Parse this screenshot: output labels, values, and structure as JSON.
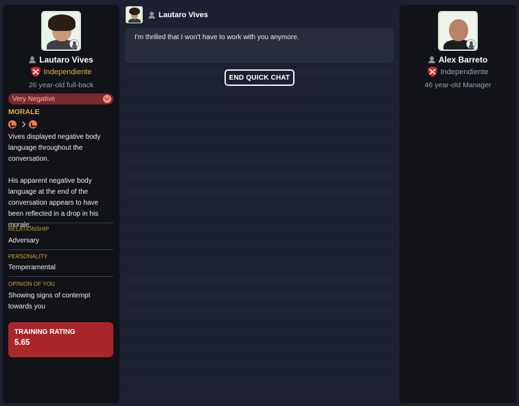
{
  "player": {
    "name": "Lautaro Vives",
    "club": "Independiente",
    "description": "26 year-old full-back",
    "morale_level": "Very Negative",
    "morale_title": "MORALE",
    "morale_text_1": "Vives displayed negative body language throughout the conversation.",
    "morale_text_2": "His apparent negative body language at the end of the conversation appears to have been reflected in a drop in his morale.",
    "relationship_label": "RELATIONSHIP",
    "relationship_value": "Adversary",
    "personality_label": "PERSONALITY",
    "personality_value": "Temperamental",
    "opinion_label": "OPINION OF YOU",
    "opinion_value": "Showing signs of contempt towards you",
    "training_label": "TRAINING RATING",
    "training_value": "5.65"
  },
  "manager": {
    "name": "Alex Barreto",
    "club": "Independiente",
    "description": "46 year-old Manager"
  },
  "chat": {
    "speaker": "Lautaro Vives",
    "message": "I'm thrilled that I won't have to work with you anymore.",
    "end_button": "END QUICK CHAT"
  },
  "colors": {
    "club": "#e3b43a",
    "morale_bad": "#7a2a2e",
    "training_bg": "#a9272a",
    "section_gold": "#d9a534"
  },
  "icons": {
    "person": "person-icon",
    "crest": "club-crest-icon",
    "morale_down": "morale-down-arrow-icon",
    "dropdown": "chevron-down-icon"
  }
}
